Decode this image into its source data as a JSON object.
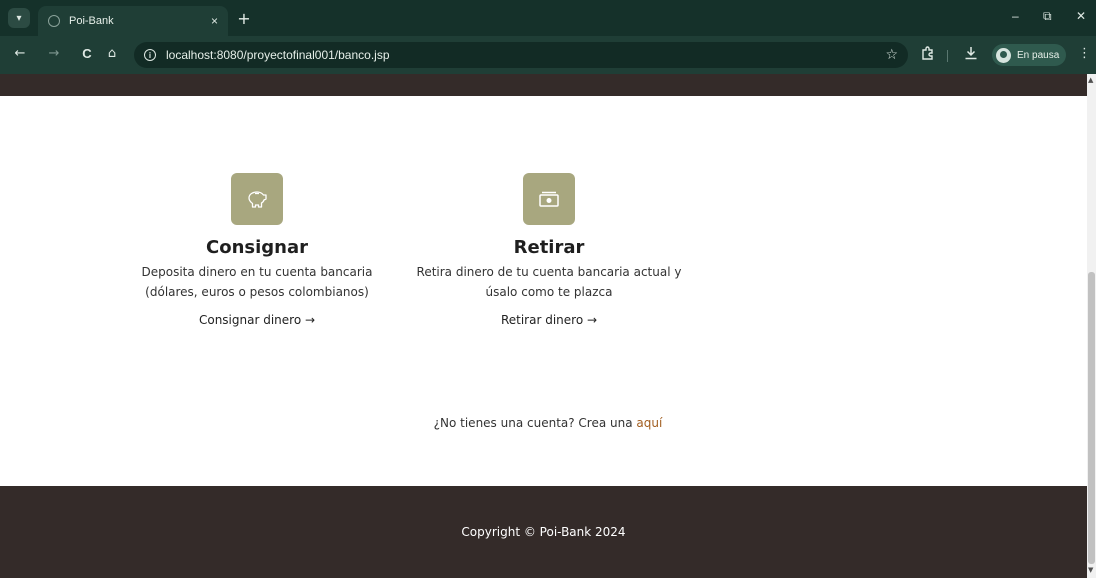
{
  "browser": {
    "tab": {
      "title": "Poi-Bank",
      "close": "×"
    },
    "new_tab": "+",
    "window_controls": {
      "minimize": "–",
      "restore": "⧉",
      "close": "✕"
    },
    "nav": {
      "back": "←",
      "forward": "→",
      "reload": "C",
      "home": "⌂"
    },
    "address_bar": {
      "url": "localhost:8080/proyectofinal001/banco.jsp"
    },
    "profile": {
      "label": "En pausa"
    },
    "icons": {
      "star": "star-icon",
      "extensions": "puzzle-icon",
      "download": "download-icon",
      "menu": "kebab-icon"
    }
  },
  "page": {
    "features": [
      {
        "icon": "piggy-bank-icon",
        "title": "Consignar",
        "desc_line1": "Deposita dinero en tu cuenta bancaria",
        "desc_line2": "(dólares, euros o pesos colombianos)",
        "link": "Consignar dinero →"
      },
      {
        "icon": "cash-icon",
        "title": "Retirar",
        "desc_line1": "Retira dinero de tu cuenta bancaria actual y",
        "desc_line2": "úsalo como te plazca",
        "link": "Retirar dinero →"
      }
    ],
    "signup": {
      "text": "¿No tienes una cuenta? Crea una ",
      "link": "aquí"
    },
    "footer": {
      "copyright": "Copyright © Poi-Bank 2024"
    }
  },
  "colors": {
    "chrome_dark": "#15312a",
    "chrome_toolbar": "#1f3e36",
    "band": "#342b29",
    "icon_bg": "#a8a77f",
    "link_accent": "#a15d1f"
  }
}
